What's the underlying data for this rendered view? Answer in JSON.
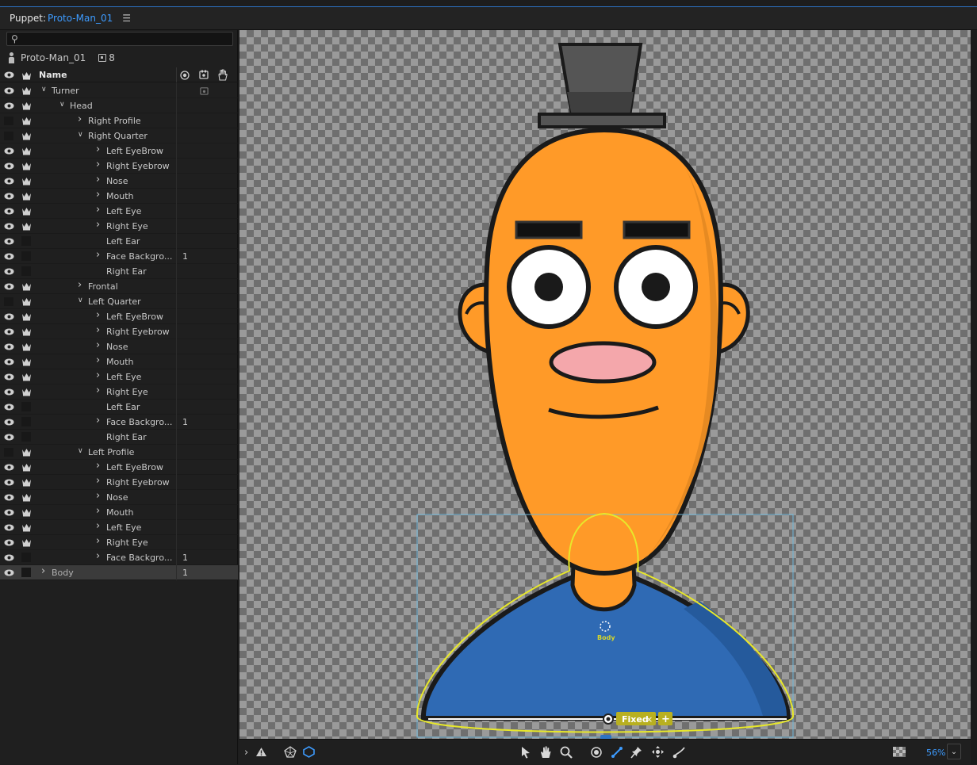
{
  "title_bar": {
    "label": "Puppet:",
    "puppet_name": "Proto-Man_01",
    "menu_icon": "hamburger-menu-icon"
  },
  "search": {
    "placeholder": "",
    "icon": "search-icon"
  },
  "puppet": {
    "name": "Proto-Man_01",
    "count": "8"
  },
  "columns": {
    "name": "Name"
  },
  "layers": [
    {
      "label": "Turner",
      "indent": 0,
      "expander": "open",
      "eye": true,
      "crown": true,
      "num": ""
    },
    {
      "label": "Head",
      "indent": 1,
      "expander": "open",
      "eye": true,
      "crown": true,
      "num": ""
    },
    {
      "label": "Right Profile",
      "indent": 2,
      "expander": "closed",
      "eye": false,
      "crown": true,
      "num": ""
    },
    {
      "label": "Right Quarter",
      "indent": 2,
      "expander": "open",
      "eye": false,
      "crown": true,
      "num": ""
    },
    {
      "label": "Left EyeBrow",
      "indent": 3,
      "expander": "closed",
      "eye": true,
      "crown": true,
      "num": ""
    },
    {
      "label": "Right Eyebrow",
      "indent": 3,
      "expander": "closed",
      "eye": true,
      "crown": true,
      "num": ""
    },
    {
      "label": "Nose",
      "indent": 3,
      "expander": "closed",
      "eye": true,
      "crown": true,
      "num": ""
    },
    {
      "label": "Mouth",
      "indent": 3,
      "expander": "closed",
      "eye": true,
      "crown": true,
      "num": ""
    },
    {
      "label": "Left Eye",
      "indent": 3,
      "expander": "closed",
      "eye": true,
      "crown": true,
      "num": ""
    },
    {
      "label": "Right Eye",
      "indent": 3,
      "expander": "closed",
      "eye": true,
      "crown": true,
      "num": ""
    },
    {
      "label": "Left Ear",
      "indent": 3,
      "expander": "none",
      "eye": true,
      "crown": false,
      "num": ""
    },
    {
      "label": "Face Backgro...",
      "indent": 3,
      "expander": "closed",
      "eye": true,
      "crown": false,
      "num": "1"
    },
    {
      "label": "Right Ear",
      "indent": 3,
      "expander": "none",
      "eye": true,
      "crown": false,
      "num": ""
    },
    {
      "label": "Frontal",
      "indent": 2,
      "expander": "closed",
      "eye": true,
      "crown": true,
      "num": ""
    },
    {
      "label": "Left Quarter",
      "indent": 2,
      "expander": "open",
      "eye": false,
      "crown": true,
      "num": ""
    },
    {
      "label": "Left EyeBrow",
      "indent": 3,
      "expander": "closed",
      "eye": true,
      "crown": true,
      "num": ""
    },
    {
      "label": "Right Eyebrow",
      "indent": 3,
      "expander": "closed",
      "eye": true,
      "crown": true,
      "num": ""
    },
    {
      "label": "Nose",
      "indent": 3,
      "expander": "closed",
      "eye": true,
      "crown": true,
      "num": ""
    },
    {
      "label": "Mouth",
      "indent": 3,
      "expander": "closed",
      "eye": true,
      "crown": true,
      "num": ""
    },
    {
      "label": "Left Eye",
      "indent": 3,
      "expander": "closed",
      "eye": true,
      "crown": true,
      "num": ""
    },
    {
      "label": "Right Eye",
      "indent": 3,
      "expander": "closed",
      "eye": true,
      "crown": true,
      "num": ""
    },
    {
      "label": "Left Ear",
      "indent": 3,
      "expander": "none",
      "eye": true,
      "crown": false,
      "num": ""
    },
    {
      "label": "Face Backgro...",
      "indent": 3,
      "expander": "closed",
      "eye": true,
      "crown": false,
      "num": "1"
    },
    {
      "label": "Right Ear",
      "indent": 3,
      "expander": "none",
      "eye": true,
      "crown": false,
      "num": ""
    },
    {
      "label": "Left Profile",
      "indent": 2,
      "expander": "open",
      "eye": false,
      "crown": true,
      "num": ""
    },
    {
      "label": "Left EyeBrow",
      "indent": 3,
      "expander": "closed",
      "eye": true,
      "crown": true,
      "num": ""
    },
    {
      "label": "Right Eyebrow",
      "indent": 3,
      "expander": "closed",
      "eye": true,
      "crown": true,
      "num": ""
    },
    {
      "label": "Nose",
      "indent": 3,
      "expander": "closed",
      "eye": true,
      "crown": true,
      "num": ""
    },
    {
      "label": "Mouth",
      "indent": 3,
      "expander": "closed",
      "eye": true,
      "crown": true,
      "num": ""
    },
    {
      "label": "Left Eye",
      "indent": 3,
      "expander": "closed",
      "eye": true,
      "crown": true,
      "num": ""
    },
    {
      "label": "Right Eye",
      "indent": 3,
      "expander": "closed",
      "eye": true,
      "crown": true,
      "num": ""
    },
    {
      "label": "Face Backgro...",
      "indent": 3,
      "expander": "closed",
      "eye": true,
      "crown": false,
      "num": "1"
    },
    {
      "label": "Body",
      "indent": 0,
      "expander": "closed",
      "eye": true,
      "crown": false,
      "num": "1",
      "selected": true
    }
  ],
  "canvas": {
    "body_label": "Body",
    "fixed_label": "Fixed",
    "colors": {
      "skin": "#ff9a28",
      "shirt": "#2f6ab4",
      "nose": "#f4a7ab",
      "hat": "#555555",
      "outline": "#1a1a1a",
      "selection": "#e8e82a",
      "bbox": "#6fb6d8"
    }
  },
  "bottom_bar": {
    "zoom": "56%",
    "tools": [
      "selection-tool-icon",
      "hand-tool-icon",
      "zoom-tool-icon",
      "origin-handle-icon",
      "stick-tool-icon",
      "pin-tool-icon",
      "dragger-tool-icon",
      "dangle-tool-icon"
    ]
  },
  "accent": "#3d9bff"
}
